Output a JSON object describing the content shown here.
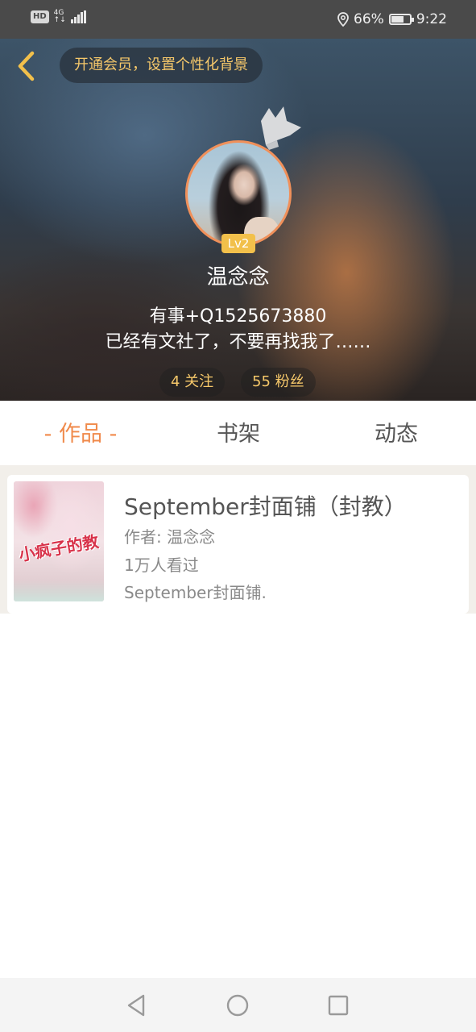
{
  "status_bar": {
    "hd": "HD",
    "network_top": "4G",
    "network_bottom": "↑↓",
    "battery_text": "66%",
    "battery_level": 0.66,
    "time": "9:22"
  },
  "header": {
    "vip_prompt": "开通会员，设置个性化背景"
  },
  "profile": {
    "level": "Lv2",
    "nickname": "温念念",
    "bio_line_1": "有事+Q1525673880",
    "bio_line_2": "已经有文社了，不要再找我了……",
    "following_label": "4 关注",
    "fans_label": "55 粉丝"
  },
  "tabs": [
    {
      "label": "- 作品 -",
      "active": true
    },
    {
      "label": "书架",
      "active": false
    },
    {
      "label": "动态",
      "active": false
    }
  ],
  "works": [
    {
      "title": "September封面铺（封教）",
      "author": "作者: 温念念",
      "views": "1万人看过",
      "description": "September封面铺.",
      "cover_text": "小疯子的教"
    }
  ],
  "colors": {
    "accent": "#f08a4b",
    "gold": "#f6c86a",
    "level_badge": "#f2c04b",
    "status_bar": "#4a4a4a"
  },
  "icons": {
    "back": "chevron-left-icon",
    "location": "location-icon",
    "nav_back": "triangle-back-icon",
    "nav_home": "circle-home-icon",
    "nav_recent": "square-recent-icon",
    "decoration": "crown-icon"
  }
}
